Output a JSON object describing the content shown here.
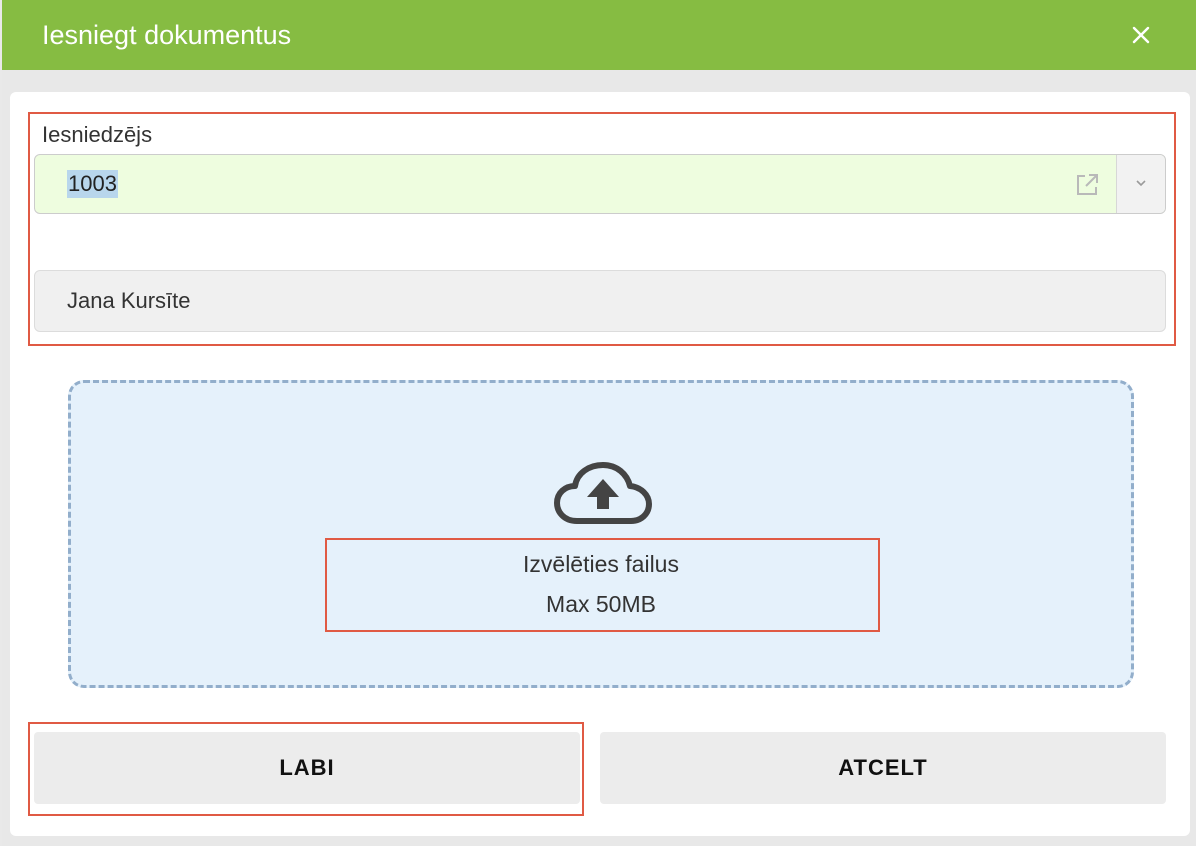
{
  "dialog": {
    "title": "Iesniegt dokumentus",
    "close_icon": "close-icon"
  },
  "submitter": {
    "label": "Iesniedzējs",
    "code_value": "1003",
    "open_icon": "external-link-icon",
    "dropdown_icon": "chevron-down-icon",
    "name_value": "Jana Kursīte"
  },
  "dropzone": {
    "icon": "cloud-upload-icon",
    "choose_label": "Izvēlēties failus",
    "max_label": "Max 50MB"
  },
  "buttons": {
    "ok_label": "LABI",
    "cancel_label": "ATCELT"
  },
  "colors": {
    "header": "#86bc42",
    "highlight": "#e05a44",
    "code_field_bg": "#eefddf",
    "dropzone_bg": "#e5f1fb",
    "dropzone_border": "#92aecb"
  }
}
